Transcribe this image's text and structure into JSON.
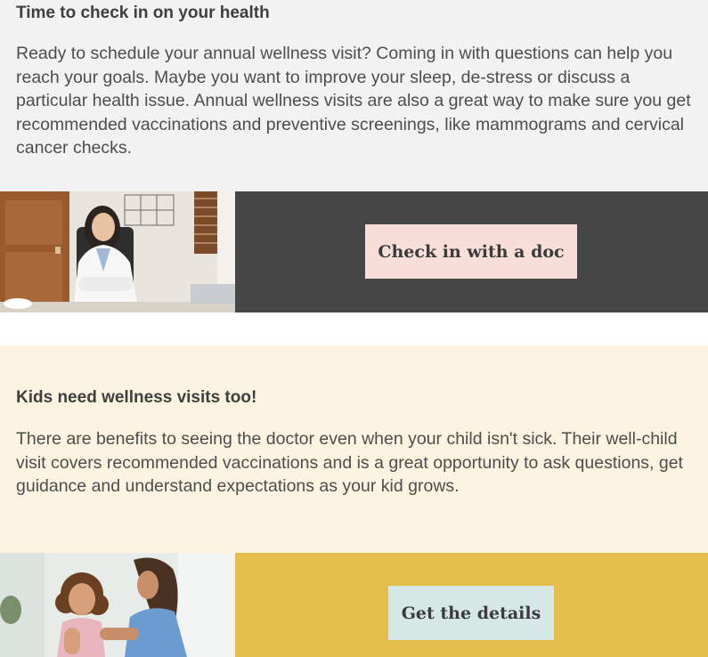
{
  "section1": {
    "heading": "Time to check in on your health",
    "body": "Ready to schedule your annual wellness visit? Coming in with questions can help you reach your goals. Maybe you want to improve your sleep, de-stress or discuss a particular health issue. Annual wellness visits are also a great way to make sure you get recommended vaccinations and preventive screenings, like mammograms and cervical cancer checks.",
    "button_label": "Check in with a doc",
    "photo": "doctor-portrait-photo",
    "colors": {
      "background": "#f2f2f2",
      "cta_band": "#464646",
      "button": "#f7ded8"
    }
  },
  "section2": {
    "heading": "Kids need wellness visits too!",
    "body": "There are benefits to seeing the doctor even when your child isn't sick. Their well-child visit covers recommended vaccinations and is a great opportunity to ask questions, get guidance and understand expectations as your kid grows.",
    "button_label": "Get the details",
    "photo": "child-vaccination-photo",
    "colors": {
      "background": "#fcf4e1",
      "cta_band": "#e4bd4c",
      "button": "#d6e8e6"
    }
  }
}
